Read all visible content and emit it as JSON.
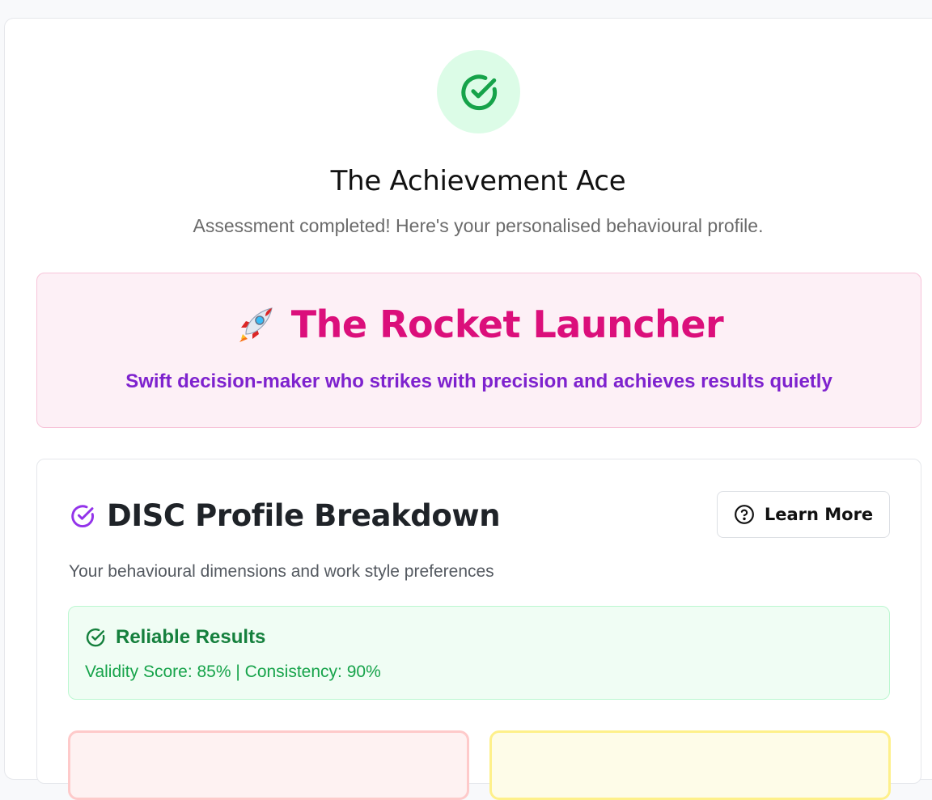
{
  "result": {
    "icon": "check-circle-icon",
    "title": "The Achievement Ace",
    "subtitle": "Assessment completed! Here's your personalised behavioural profile."
  },
  "persona": {
    "emoji": "🚀",
    "title": "The Rocket Launcher",
    "description": "Swift decision-maker who strikes with precision and achieves results quietly"
  },
  "disc": {
    "title": "DISC Profile Breakdown",
    "description": "Your behavioural dimensions and work style preferences",
    "learn_more_label": "Learn More",
    "reliability": {
      "title": "Reliable Results",
      "stats": "Validity Score: 85% | Consistency: 90%"
    }
  },
  "colors": {
    "success": "#16a34a",
    "success_bg": "#dcfce7",
    "persona_pink": "#db0f7b",
    "persona_purple": "#7e22ce",
    "disc_icon": "#9333ea"
  }
}
